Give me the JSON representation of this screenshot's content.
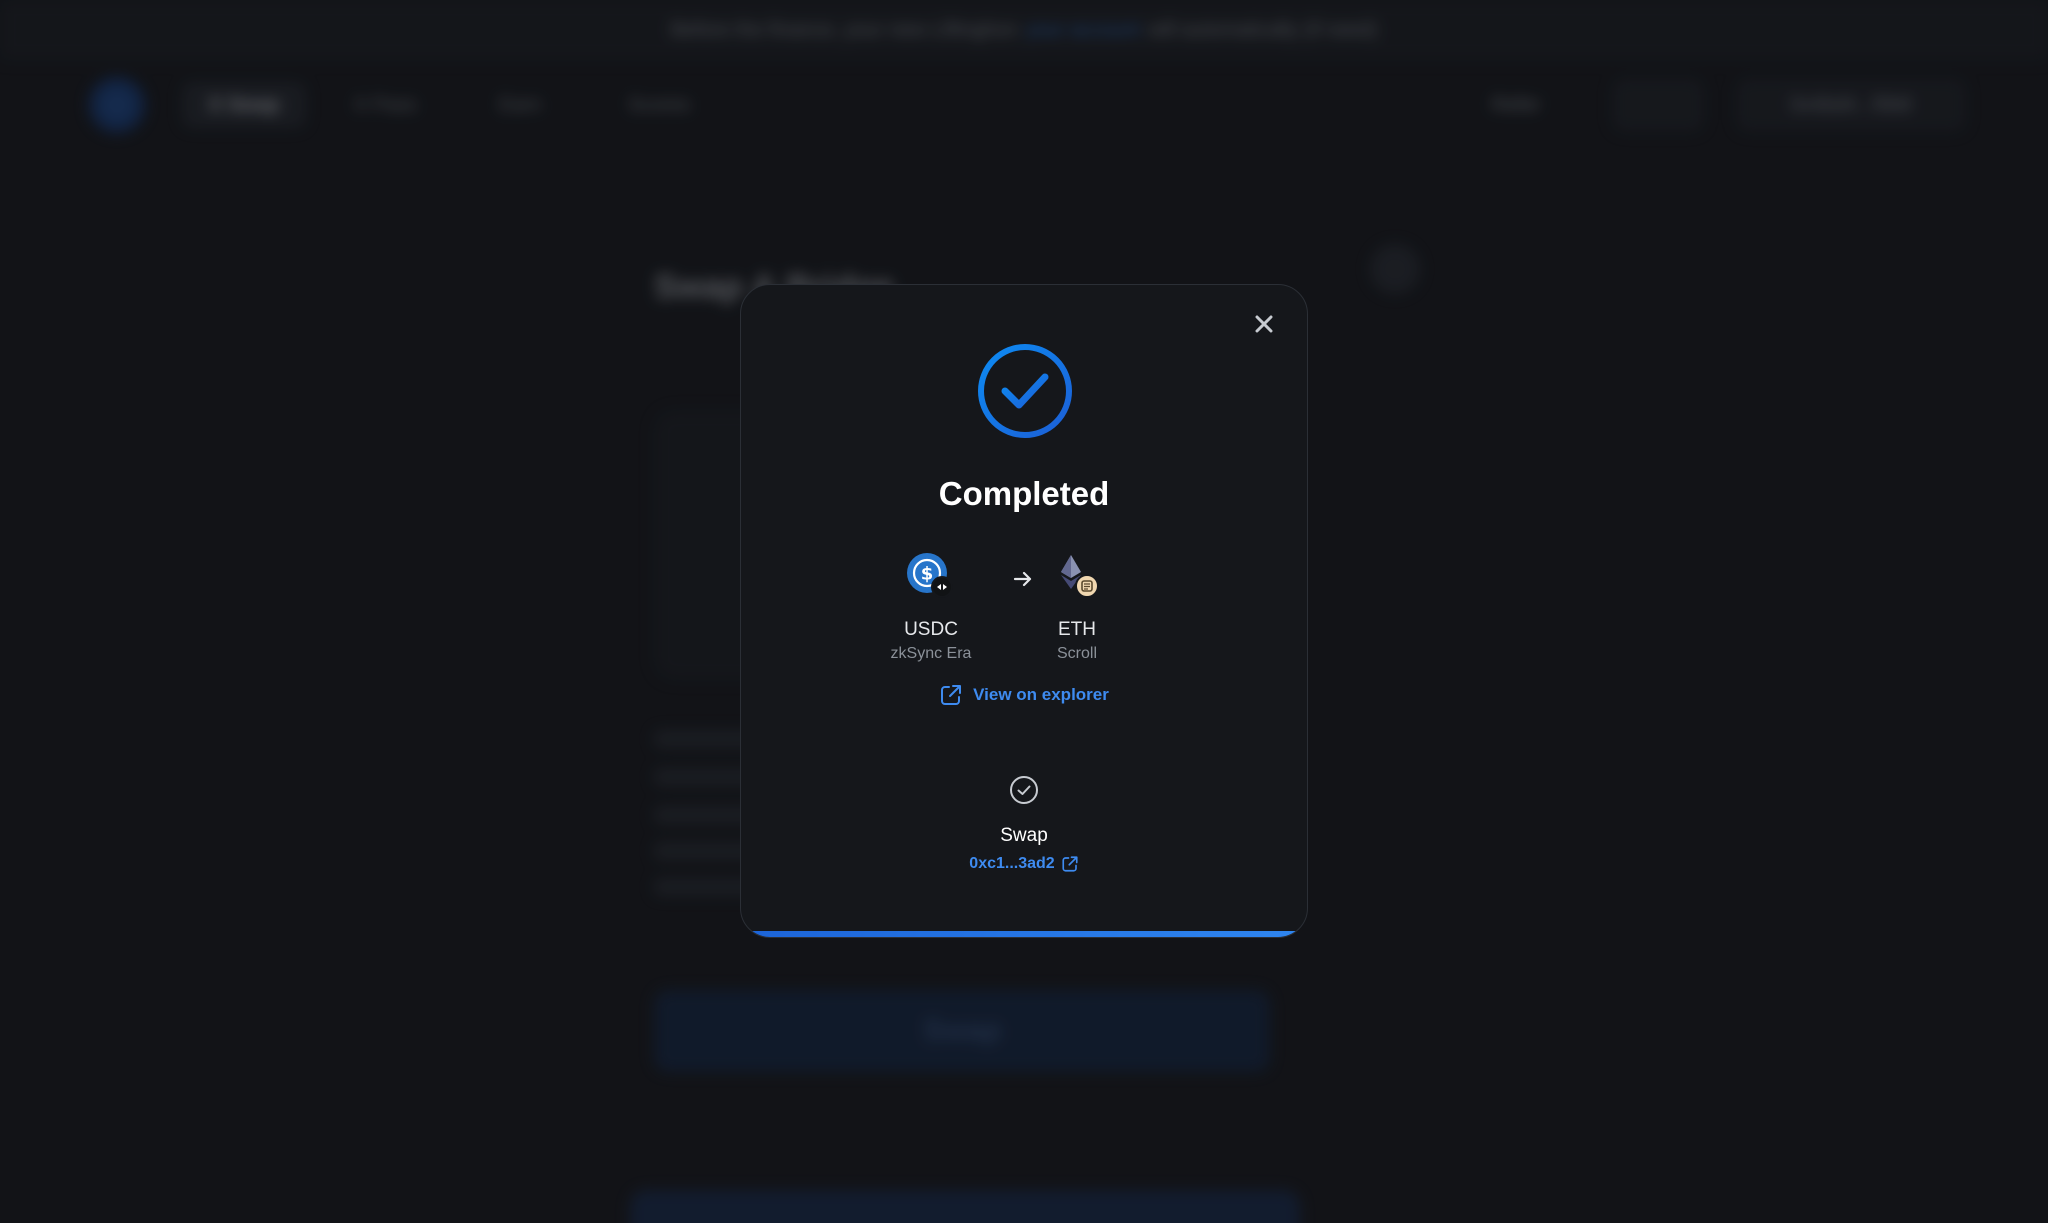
{
  "background": {
    "announcement": {
      "text_before": "Before the finance, your new Liftinghon",
      "link": "your account",
      "text_after": "will automatically (if need)"
    },
    "nav": {
      "items": [
        "X Swap",
        "X Pass",
        "Earn",
        "Scores"
      ],
      "right_items": [
        "Refer",
        "0x4bd4...f0b8"
      ]
    },
    "page_title": "Swap & Bridge",
    "primary_button": "Swap"
  },
  "modal": {
    "title": "Completed",
    "from_token": {
      "symbol": "USDC",
      "network": "zkSync Era",
      "icon": "usdc-icon",
      "badge": "zksync-badge-icon"
    },
    "to_token": {
      "symbol": "ETH",
      "network": "Scroll",
      "icon": "eth-icon",
      "badge": "scroll-badge-icon"
    },
    "explorer_link": "View on explorer",
    "step": {
      "label": "Swap",
      "hash": "0xc1...3ad2"
    },
    "progress": 1.0,
    "colors": {
      "accent": "#3e8bf0",
      "success_gradient_start": "#0d8bf2",
      "success_gradient_end": "#1c5fd6"
    }
  }
}
